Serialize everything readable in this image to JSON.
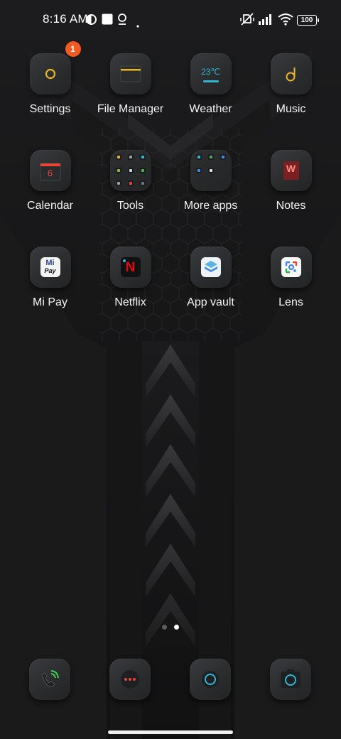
{
  "status_bar": {
    "time": "8:16 AM",
    "battery": "100",
    "icons": [
      "notification-icon",
      "square-icon",
      "location-icon",
      "dot-icon",
      "mute-vibrate-icon",
      "signal-icon",
      "wifi-icon",
      "battery-icon"
    ]
  },
  "apps": [
    {
      "label": "Settings",
      "icon": "gear-icon",
      "badge": "1"
    },
    {
      "label": "File Manager",
      "icon": "folder-icon"
    },
    {
      "label": "Weather",
      "icon": "weather-icon",
      "temp": "23℃"
    },
    {
      "label": "Music",
      "icon": "music-note-icon"
    },
    {
      "label": "Calendar",
      "icon": "calendar-icon",
      "day": "6"
    },
    {
      "label": "Tools",
      "icon": "folder-tools"
    },
    {
      "label": "More apps",
      "icon": "folder-more-apps"
    },
    {
      "label": "Notes",
      "icon": "notes-icon",
      "glyph": "W"
    },
    {
      "label": "Mi Pay",
      "icon": "mi-pay-icon",
      "line1": "Mi",
      "line2": "Pay"
    },
    {
      "label": "Netflix",
      "icon": "netflix-icon",
      "glyph": "N"
    },
    {
      "label": "App vault",
      "icon": "app-vault-icon"
    },
    {
      "label": "Lens",
      "icon": "lens-icon"
    }
  ],
  "dock": [
    {
      "name": "phone",
      "icon": "phone-icon"
    },
    {
      "name": "messaging",
      "icon": "message-icon"
    },
    {
      "name": "browser",
      "icon": "browser-icon"
    },
    {
      "name": "camera",
      "icon": "camera-icon"
    }
  ],
  "pages": {
    "count": 2,
    "current": 2
  },
  "colors": {
    "accent_yellow": "#e8b426",
    "accent_cyan": "#2fb6d8",
    "badge": "#f15a22",
    "red": "#e8453a"
  }
}
